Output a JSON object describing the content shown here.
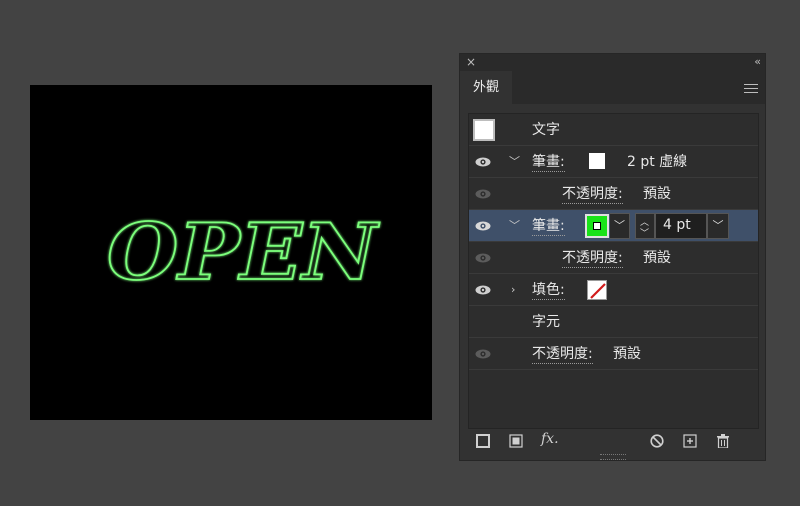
{
  "canvas": {
    "artwork_text": "OPEN",
    "stroke_color": "#7CFF7C"
  },
  "panel": {
    "close_label": "×",
    "collapse_label": "‹‹",
    "tab_label": "外觀",
    "rows": {
      "text_label": "文字",
      "stroke1_label": "筆畫:",
      "stroke1_value": "2 pt 虛線",
      "opacity1_label": "不透明度:",
      "opacity1_value": "預設",
      "stroke2_label": "筆畫:",
      "stroke2_weight": "4 pt",
      "opacity2_label": "不透明度:",
      "opacity2_value": "預設",
      "fill_label": "填色:",
      "chars_label": "字元",
      "opacity3_label": "不透明度:",
      "opacity3_value": "預設"
    },
    "colors": {
      "selected_row": "#3f5069",
      "stroke_swatch": "#19e219",
      "none_slash": "#d11b1b"
    }
  }
}
